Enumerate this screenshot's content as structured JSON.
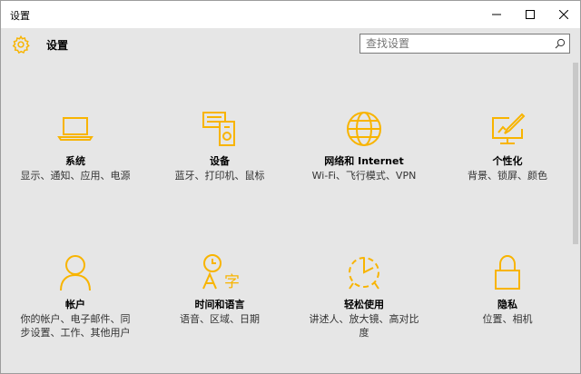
{
  "window": {
    "title": "设置"
  },
  "header": {
    "title": "设置",
    "search_placeholder": "查找设置"
  },
  "colors": {
    "accent": "#f8b400",
    "background": "#e6e6e6"
  },
  "tiles": [
    {
      "icon": "laptop-icon",
      "title": "系统",
      "desc": "显示、通知、应用、电源"
    },
    {
      "icon": "devices-icon",
      "title": "设备",
      "desc": "蓝牙、打印机、鼠标"
    },
    {
      "icon": "globe-icon",
      "title": "网络和 Internet",
      "desc": "Wi-Fi、飞行模式、VPN"
    },
    {
      "icon": "personalization-icon",
      "title": "个性化",
      "desc": "背景、锁屏、颜色"
    },
    {
      "icon": "person-icon",
      "title": "帐户",
      "desc": "你的帐户、电子邮件、同步设置、工作、其他用户"
    },
    {
      "icon": "time-language-icon",
      "title": "时间和语言",
      "desc": "语音、区域、日期"
    },
    {
      "icon": "ease-of-access-icon",
      "title": "轻松使用",
      "desc": "讲述人、放大镜、高对比度"
    },
    {
      "icon": "lock-icon",
      "title": "隐私",
      "desc": "位置、相机"
    }
  ]
}
